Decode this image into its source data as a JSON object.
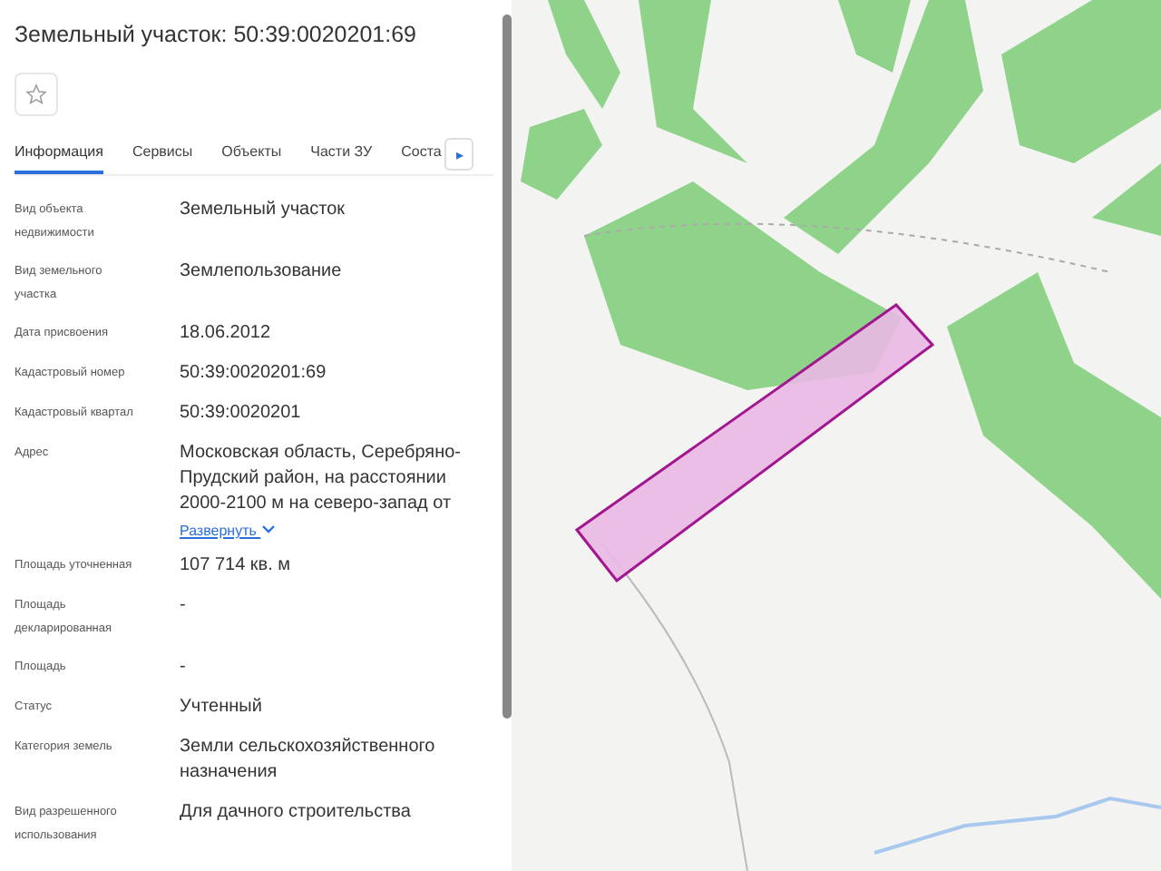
{
  "panel": {
    "title": "Земельный участок: 50:39:0020201:69",
    "favorite": false,
    "tabs": [
      {
        "label": "Информация",
        "selected": true
      },
      {
        "label": "Сервисы",
        "selected": false
      },
      {
        "label": "Объекты",
        "selected": false
      },
      {
        "label": "Части ЗУ",
        "selected": false
      },
      {
        "label": "Соста",
        "selected": false
      }
    ],
    "tab_scroll": "▸",
    "rows": [
      {
        "label": "Вид объекта недвижимости",
        "value": "Земельный участок"
      },
      {
        "label": "Вид земельного участка",
        "value": "Землепользование"
      },
      {
        "label": "Дата присвоения",
        "value": "18.06.2012"
      },
      {
        "label": "Кадастровый номер",
        "value": "50:39:0020201:69"
      },
      {
        "label": "Кадастровый квартал",
        "value": "50:39:0020201"
      },
      {
        "label": "Адрес",
        "value": "Московская область, Серебряно-Прудский район, на расстоянии 2000-2100 м на северо-запад от",
        "link": "Развернуть"
      },
      {
        "label": "Площадь уточненная",
        "value": "107 714 кв. м"
      },
      {
        "label": "Площадь декларированная",
        "value": "-"
      },
      {
        "label": "Площадь",
        "value": "-"
      },
      {
        "label": "Статус",
        "value": "Учтенный"
      },
      {
        "label": "Категория земель",
        "value": "Земли сельскохозяйственного назначения"
      },
      {
        "label": "Вид разрешенного использования",
        "value": "Для дачного строительства"
      }
    ]
  },
  "map": {
    "parcel_highlighted": true
  }
}
